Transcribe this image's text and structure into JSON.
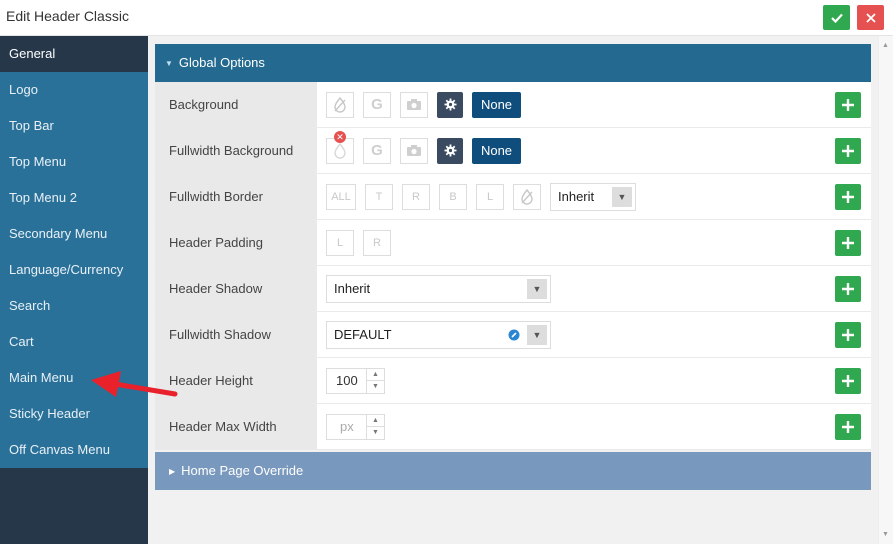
{
  "window": {
    "title": "Edit Header Classic"
  },
  "sidebar": {
    "items": [
      {
        "label": "General",
        "active": true
      },
      {
        "label": "Logo"
      },
      {
        "label": "Top Bar"
      },
      {
        "label": "Top Menu"
      },
      {
        "label": "Top Menu 2"
      },
      {
        "label": "Secondary Menu"
      },
      {
        "label": "Language/Currency"
      },
      {
        "label": "Search"
      },
      {
        "label": "Cart"
      },
      {
        "label": "Main Menu"
      },
      {
        "label": "Sticky Header"
      },
      {
        "label": "Off Canvas Menu"
      }
    ]
  },
  "sections": {
    "global_options": "Global Options",
    "home_page_override": "Home Page Override"
  },
  "rows": {
    "background": {
      "label": "Background",
      "none_label": "None"
    },
    "fullwidth_background": {
      "label": "Fullwidth Background",
      "none_label": "None"
    },
    "fullwidth_border": {
      "label": "Fullwidth Border",
      "sides": [
        "ALL",
        "T",
        "R",
        "B",
        "L"
      ],
      "select_value": "Inherit"
    },
    "header_padding": {
      "label": "Header Padding",
      "sides": [
        "L",
        "R"
      ]
    },
    "header_shadow": {
      "label": "Header Shadow",
      "select_value": "Inherit"
    },
    "fullwidth_shadow": {
      "label": "Fullwidth Shadow",
      "select_value": "DEFAULT"
    },
    "header_height": {
      "label": "Header Height",
      "value": "100"
    },
    "header_max_width": {
      "label": "Header Max Width",
      "placeholder": "px"
    }
  },
  "colors": {
    "sidebar_item": "#2a7199",
    "sidebar_active": "#26374a",
    "section_header": "#236990",
    "subsection_header": "#7998bd",
    "add_button": "#2fa84f",
    "none_button": "#0f4d7d",
    "close_button": "#e55050"
  }
}
